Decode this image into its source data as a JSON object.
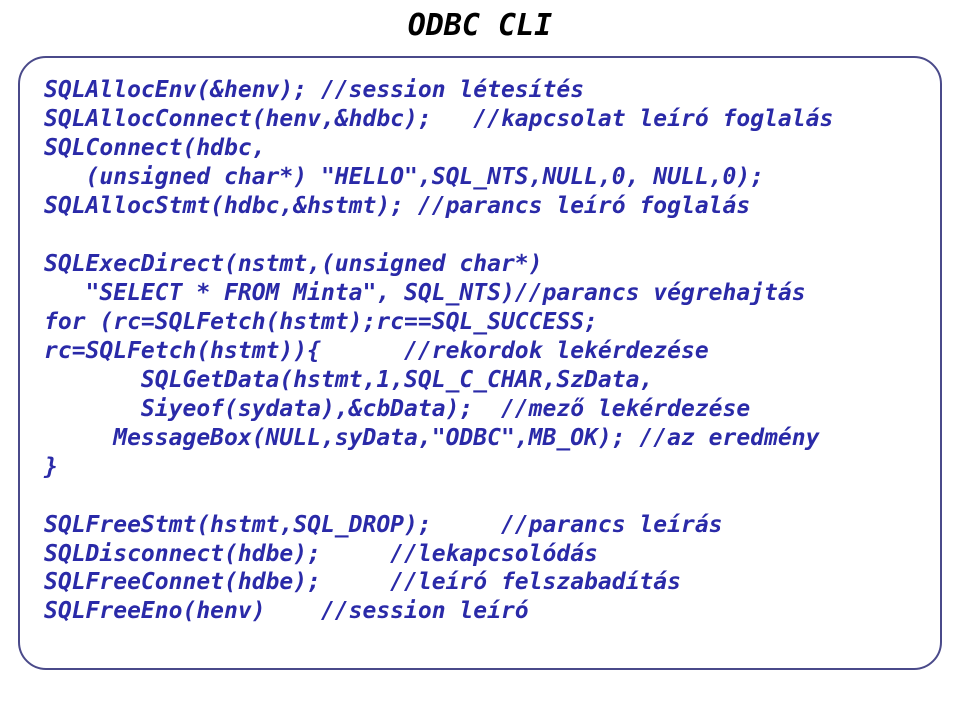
{
  "title": "ODBC CLI",
  "code": "SQLAllocEnv(&henv); //session létesítés\nSQLAllocConnect(henv,&hdbc);   //kapcsolat leíró foglalás\nSQLConnect(hdbc,\n   (unsigned char*) \"HELLO\",SQL_NTS,NULL,0, NULL,0);\nSQLAllocStmt(hdbc,&hstmt); //parancs leíró foglalás\n\nSQLExecDirect(nstmt,(unsigned char*)\n   \"SELECT * FROM Minta\", SQL_NTS)//parancs végrehajtás\nfor (rc=SQLFetch(hstmt);rc==SQL_SUCCESS;\nrc=SQLFetch(hstmt)){      //rekordok lekérdezése\n       SQLGetData(hstmt,1,SQL_C_CHAR,SzData,\n       Siyeof(sydata),&cbData);  //mező lekérdezése\n     MessageBox(NULL,syData,\"ODBC\",MB_OK); //az eredmény\n}\n\nSQLFreeStmt(hstmt,SQL_DROP);     //parancs leírás\nSQLDisconnect(hdbe);     //lekapcsolódás\nSQLFreeConnet(hdbe);     //leíró felszabadítás\nSQLFreeEno(henv)    //session leíró"
}
